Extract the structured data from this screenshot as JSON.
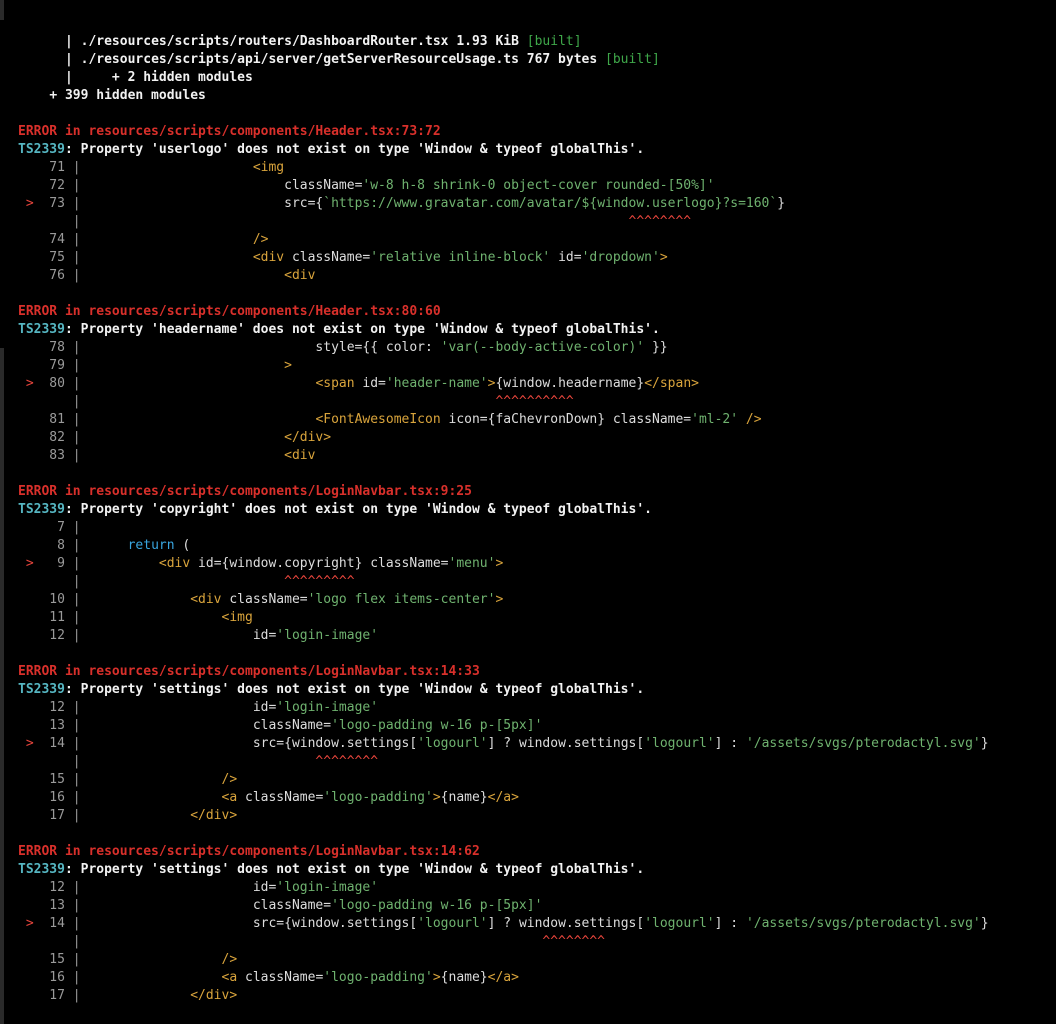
{
  "build_output": [
    {
      "prefix": "    | ",
      "path": "./resources/scripts/routers/DashboardRouter.tsx",
      "size": "1.93 KiB",
      "status": "[built]"
    },
    {
      "prefix": "    | ",
      "path": "./resources/scripts/api/server/getServerResourceUsage.ts",
      "size": "767 bytes",
      "status": "[built]"
    },
    {
      "prefix": "    |     ",
      "path": "+ 2 hidden modules",
      "size": "",
      "status": ""
    },
    {
      "prefix": "  ",
      "path": "+ 399 hidden modules",
      "size": "",
      "status": ""
    }
  ],
  "errors": [
    {
      "heading": "ERROR in resources/scripts/components/Header.tsx:73:72",
      "code": "TS2339",
      "message": ": Property 'userlogo' does not exist on type 'Window & typeof globalThis'.",
      "lines": [
        {
          "num": "71",
          "marker": "",
          "segments": [
            {
              "c": "t",
              "v": "                     "
            },
            {
              "c": "tag",
              "v": "<img"
            }
          ]
        },
        {
          "num": "72",
          "marker": "",
          "segments": [
            {
              "c": "t",
              "v": "                         className"
            },
            {
              "c": "t",
              "v": "="
            },
            {
              "c": "str",
              "v": "'w-8 h-8 shrink-0 object-cover rounded-[50%]'"
            }
          ]
        },
        {
          "num": "73",
          "marker": ">",
          "segments": [
            {
              "c": "t",
              "v": "                         src"
            },
            {
              "c": "t",
              "v": "={"
            },
            {
              "c": "str",
              "v": "`https://www.gravatar.com/avatar/${window.userlogo}?s=160`"
            },
            {
              "c": "t",
              "v": "}"
            }
          ]
        },
        {
          "num": "",
          "marker": "",
          "segments": [
            {
              "c": "caret",
              "v": "                                                                     ^^^^^^^^"
            }
          ]
        },
        {
          "num": "74",
          "marker": "",
          "segments": [
            {
              "c": "t",
              "v": "                     "
            },
            {
              "c": "tag",
              "v": "/>"
            }
          ]
        },
        {
          "num": "75",
          "marker": "",
          "segments": [
            {
              "c": "t",
              "v": "                     "
            },
            {
              "c": "tag",
              "v": "<div"
            },
            {
              "c": "t",
              "v": " className="
            },
            {
              "c": "str",
              "v": "'relative inline-block'"
            },
            {
              "c": "t",
              "v": " id="
            },
            {
              "c": "str",
              "v": "'dropdown'"
            },
            {
              "c": "tag",
              "v": ">"
            }
          ]
        },
        {
          "num": "76",
          "marker": "",
          "segments": [
            {
              "c": "t",
              "v": "                         "
            },
            {
              "c": "tag",
              "v": "<div"
            }
          ]
        }
      ]
    },
    {
      "heading": "ERROR in resources/scripts/components/Header.tsx:80:60",
      "code": "TS2339",
      "message": ": Property 'headername' does not exist on type 'Window & typeof globalThis'.",
      "lines": [
        {
          "num": "78",
          "marker": "",
          "segments": [
            {
              "c": "t",
              "v": "                             style={{ color: "
            },
            {
              "c": "str",
              "v": "'var(--body-active-color)'"
            },
            {
              "c": "t",
              "v": " }}"
            }
          ]
        },
        {
          "num": "79",
          "marker": "",
          "segments": [
            {
              "c": "t",
              "v": "                         "
            },
            {
              "c": "tag",
              "v": ">"
            }
          ]
        },
        {
          "num": "80",
          "marker": ">",
          "segments": [
            {
              "c": "t",
              "v": "                             "
            },
            {
              "c": "tag",
              "v": "<span"
            },
            {
              "c": "t",
              "v": " id="
            },
            {
              "c": "str",
              "v": "'header-name'"
            },
            {
              "c": "tag",
              "v": ">"
            },
            {
              "c": "t",
              "v": "{window.headername}"
            },
            {
              "c": "tag",
              "v": "</span>"
            }
          ]
        },
        {
          "num": "",
          "marker": "",
          "segments": [
            {
              "c": "caret",
              "v": "                                                    ^^^^^^^^^^"
            }
          ]
        },
        {
          "num": "81",
          "marker": "",
          "segments": [
            {
              "c": "t",
              "v": "                             "
            },
            {
              "c": "tag",
              "v": "<FontAwesomeIcon"
            },
            {
              "c": "t",
              "v": " icon={faChevronDown} className="
            },
            {
              "c": "str",
              "v": "'ml-2'"
            },
            {
              "c": "tag",
              "v": " />"
            }
          ]
        },
        {
          "num": "82",
          "marker": "",
          "segments": [
            {
              "c": "t",
              "v": "                         "
            },
            {
              "c": "tag",
              "v": "</div>"
            }
          ]
        },
        {
          "num": "83",
          "marker": "",
          "segments": [
            {
              "c": "t",
              "v": "                         "
            },
            {
              "c": "tag",
              "v": "<div"
            }
          ]
        }
      ]
    },
    {
      "heading": "ERROR in resources/scripts/components/LoginNavbar.tsx:9:25",
      "code": "TS2339",
      "message": ": Property 'copyright' does not exist on type 'Window & typeof globalThis'.",
      "lines": [
        {
          "num": "7",
          "marker": "",
          "segments": []
        },
        {
          "num": "8",
          "marker": "",
          "segments": [
            {
              "c": "t",
              "v": "     "
            },
            {
              "c": "kw",
              "v": "return"
            },
            {
              "c": "t",
              "v": " ("
            }
          ]
        },
        {
          "num": "9",
          "marker": ">",
          "segments": [
            {
              "c": "t",
              "v": "         "
            },
            {
              "c": "tag",
              "v": "<div"
            },
            {
              "c": "t",
              "v": " id={window.copyright} className="
            },
            {
              "c": "str",
              "v": "'menu'"
            },
            {
              "c": "tag",
              "v": ">"
            }
          ]
        },
        {
          "num": "",
          "marker": "",
          "segments": [
            {
              "c": "caret",
              "v": "                         ^^^^^^^^^"
            }
          ]
        },
        {
          "num": "10",
          "marker": "",
          "segments": [
            {
              "c": "t",
              "v": "             "
            },
            {
              "c": "tag",
              "v": "<div"
            },
            {
              "c": "t",
              "v": " className="
            },
            {
              "c": "str",
              "v": "'logo flex items-center'"
            },
            {
              "c": "tag",
              "v": ">"
            }
          ]
        },
        {
          "num": "11",
          "marker": "",
          "segments": [
            {
              "c": "t",
              "v": "                 "
            },
            {
              "c": "tag",
              "v": "<img"
            }
          ]
        },
        {
          "num": "12",
          "marker": "",
          "segments": [
            {
              "c": "t",
              "v": "                     id="
            },
            {
              "c": "str",
              "v": "'login-image'"
            }
          ]
        }
      ]
    },
    {
      "heading": "ERROR in resources/scripts/components/LoginNavbar.tsx:14:33",
      "code": "TS2339",
      "message": ": Property 'settings' does not exist on type 'Window & typeof globalThis'.",
      "lines": [
        {
          "num": "12",
          "marker": "",
          "segments": [
            {
              "c": "t",
              "v": "                     id="
            },
            {
              "c": "str",
              "v": "'login-image'"
            }
          ]
        },
        {
          "num": "13",
          "marker": "",
          "segments": [
            {
              "c": "t",
              "v": "                     className="
            },
            {
              "c": "str",
              "v": "'logo-padding w-16 p-[5px]'"
            }
          ]
        },
        {
          "num": "14",
          "marker": ">",
          "segments": [
            {
              "c": "t",
              "v": "                     src={window.settings["
            },
            {
              "c": "str",
              "v": "'logourl'"
            },
            {
              "c": "t",
              "v": "] ? window.settings["
            },
            {
              "c": "str",
              "v": "'logourl'"
            },
            {
              "c": "t",
              "v": "] : "
            },
            {
              "c": "str",
              "v": "'/assets/svgs/pterodactyl.svg'"
            },
            {
              "c": "t",
              "v": "}"
            }
          ]
        },
        {
          "num": "",
          "marker": "",
          "segments": [
            {
              "c": "caret",
              "v": "                             ^^^^^^^^"
            }
          ]
        },
        {
          "num": "15",
          "marker": "",
          "segments": [
            {
              "c": "t",
              "v": "                 "
            },
            {
              "c": "tag",
              "v": "/>"
            }
          ]
        },
        {
          "num": "16",
          "marker": "",
          "segments": [
            {
              "c": "t",
              "v": "                 "
            },
            {
              "c": "tag",
              "v": "<a"
            },
            {
              "c": "t",
              "v": " className="
            },
            {
              "c": "str",
              "v": "'logo-padding'"
            },
            {
              "c": "tag",
              "v": ">"
            },
            {
              "c": "t",
              "v": "{name}"
            },
            {
              "c": "tag",
              "v": "</a>"
            }
          ]
        },
        {
          "num": "17",
          "marker": "",
          "segments": [
            {
              "c": "t",
              "v": "             "
            },
            {
              "c": "tag",
              "v": "</div>"
            }
          ]
        }
      ]
    },
    {
      "heading": "ERROR in resources/scripts/components/LoginNavbar.tsx:14:62",
      "code": "TS2339",
      "message": ": Property 'settings' does not exist on type 'Window & typeof globalThis'.",
      "lines": [
        {
          "num": "12",
          "marker": "",
          "segments": [
            {
              "c": "t",
              "v": "                     id="
            },
            {
              "c": "str",
              "v": "'login-image'"
            }
          ]
        },
        {
          "num": "13",
          "marker": "",
          "segments": [
            {
              "c": "t",
              "v": "                     className="
            },
            {
              "c": "str",
              "v": "'logo-padding w-16 p-[5px]'"
            }
          ]
        },
        {
          "num": "14",
          "marker": ">",
          "segments": [
            {
              "c": "t",
              "v": "                     src={window.settings["
            },
            {
              "c": "str",
              "v": "'logourl'"
            },
            {
              "c": "t",
              "v": "] ? window.settings["
            },
            {
              "c": "str",
              "v": "'logourl'"
            },
            {
              "c": "t",
              "v": "] : "
            },
            {
              "c": "str",
              "v": "'/assets/svgs/pterodactyl.svg'"
            },
            {
              "c": "t",
              "v": "}"
            }
          ]
        },
        {
          "num": "",
          "marker": "",
          "segments": [
            {
              "c": "caret",
              "v": "                                                          ^^^^^^^^"
            }
          ]
        },
        {
          "num": "15",
          "marker": "",
          "segments": [
            {
              "c": "t",
              "v": "                 "
            },
            {
              "c": "tag",
              "v": "/>"
            }
          ]
        },
        {
          "num": "16",
          "marker": "",
          "segments": [
            {
              "c": "t",
              "v": "                 "
            },
            {
              "c": "tag",
              "v": "<a"
            },
            {
              "c": "t",
              "v": " className="
            },
            {
              "c": "str",
              "v": "'logo-padding'"
            },
            {
              "c": "tag",
              "v": ">"
            },
            {
              "c": "t",
              "v": "{name}"
            },
            {
              "c": "tag",
              "v": "</a>"
            }
          ]
        },
        {
          "num": "17",
          "marker": "",
          "segments": [
            {
              "c": "t",
              "v": "             "
            },
            {
              "c": "tag",
              "v": "</div>"
            }
          ]
        }
      ]
    }
  ]
}
